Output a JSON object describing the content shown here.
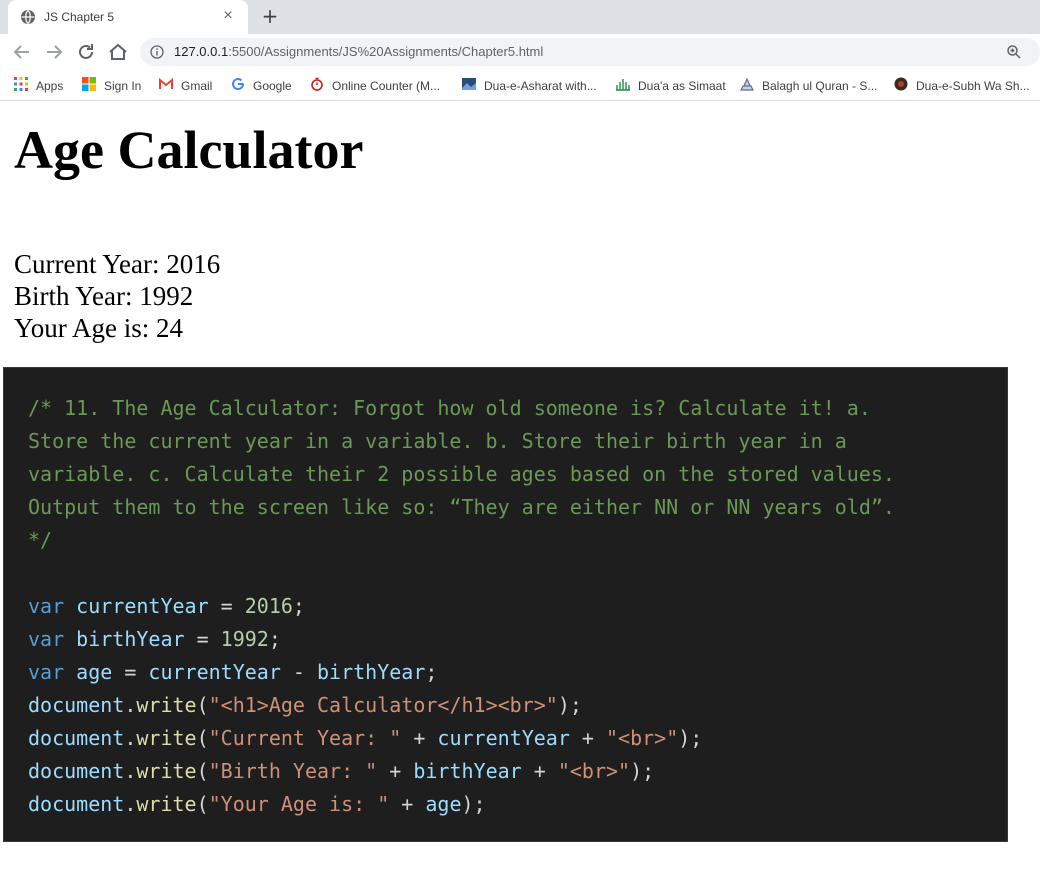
{
  "browser": {
    "tab": {
      "title": "JS Chapter 5",
      "close": "×"
    },
    "new_tab": "+",
    "url": {
      "host": "127.0.0.1",
      "path": ":5500/Assignments/JS%20Assignments/Chapter5.html"
    },
    "bookmarks": [
      {
        "label": "Apps",
        "icon": "apps-grid-icon"
      },
      {
        "label": "Sign In",
        "icon": "microsoft-icon"
      },
      {
        "label": "Gmail",
        "icon": "gmail-icon"
      },
      {
        "label": "Google",
        "icon": "google-icon"
      },
      {
        "label": "Online Counter (M...",
        "icon": "counter-icon"
      },
      {
        "label": "Dua-e-Asharat with...",
        "icon": "bookmark-image-icon"
      },
      {
        "label": "Dua'a as Simaat",
        "icon": "bookmark-image-icon"
      },
      {
        "label": "Balagh ul Quran - S...",
        "icon": "bookmark-image-icon"
      },
      {
        "label": "Dua-e-Subh Wa Sh...",
        "icon": "bookmark-image-icon"
      }
    ]
  },
  "page": {
    "heading": "Age Calculator",
    "lines": [
      "Current Year: 2016",
      "Birth Year: 1992",
      "Your Age is: 24"
    ]
  },
  "code": {
    "comment": [
      "/* 11. The Age Calculator: Forgot how old someone is? Calculate it! a.",
      "Store the current year in a variable. b. Store their birth year in a",
      "variable. c. Calculate their 2 possible ages based on the stored values.",
      "Output them to the screen like so: “They are either NN or NN years old”.",
      "*/"
    ],
    "kw": "var",
    "v_current": "currentYear",
    "v_birth": "birthYear",
    "v_age": "age",
    "n_current": "2016",
    "n_birth": "1992",
    "obj": "document",
    "fn": "write",
    "s1": "\"<h1>Age Calculator</h1><br>\"",
    "s2": "\"Current Year: \"",
    "s3": "\"<br>\"",
    "s4": "\"Birth Year: \"",
    "s5": "\"Your Age is: \""
  }
}
